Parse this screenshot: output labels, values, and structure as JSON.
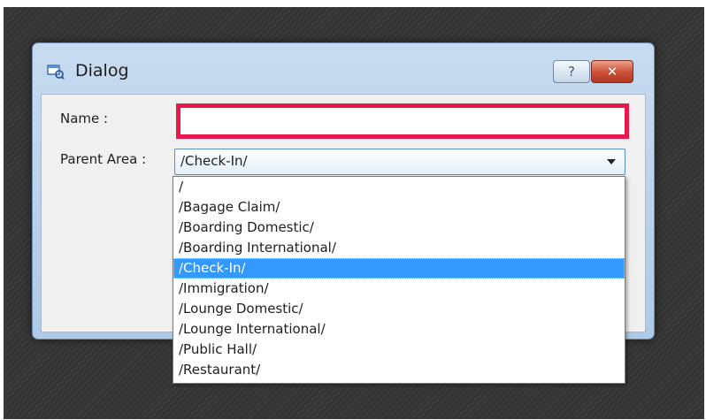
{
  "dialog": {
    "title": "Dialog",
    "help_label": "?",
    "close_label": "✕"
  },
  "form": {
    "name_label": "Name :",
    "name_value": "",
    "parent_label": "Parent Area :",
    "parent_value": "/Check-In/"
  },
  "dropdown": {
    "selected_index": 4,
    "options": [
      "/",
      "/Bagage Claim/",
      "/Boarding Domestic/",
      "/Boarding International/",
      "/Check-In/",
      "/Immigration/",
      "/Lounge Domestic/",
      "/Lounge International/",
      "/Public Hall/",
      "/Restaurant/"
    ]
  },
  "colors": {
    "highlight_border": "#e8184a",
    "selection": "#3399ff"
  },
  "icons": {
    "app": "dialog-app-icon",
    "help": "help-icon",
    "close": "close-icon",
    "combo": "chevron-down-icon"
  }
}
